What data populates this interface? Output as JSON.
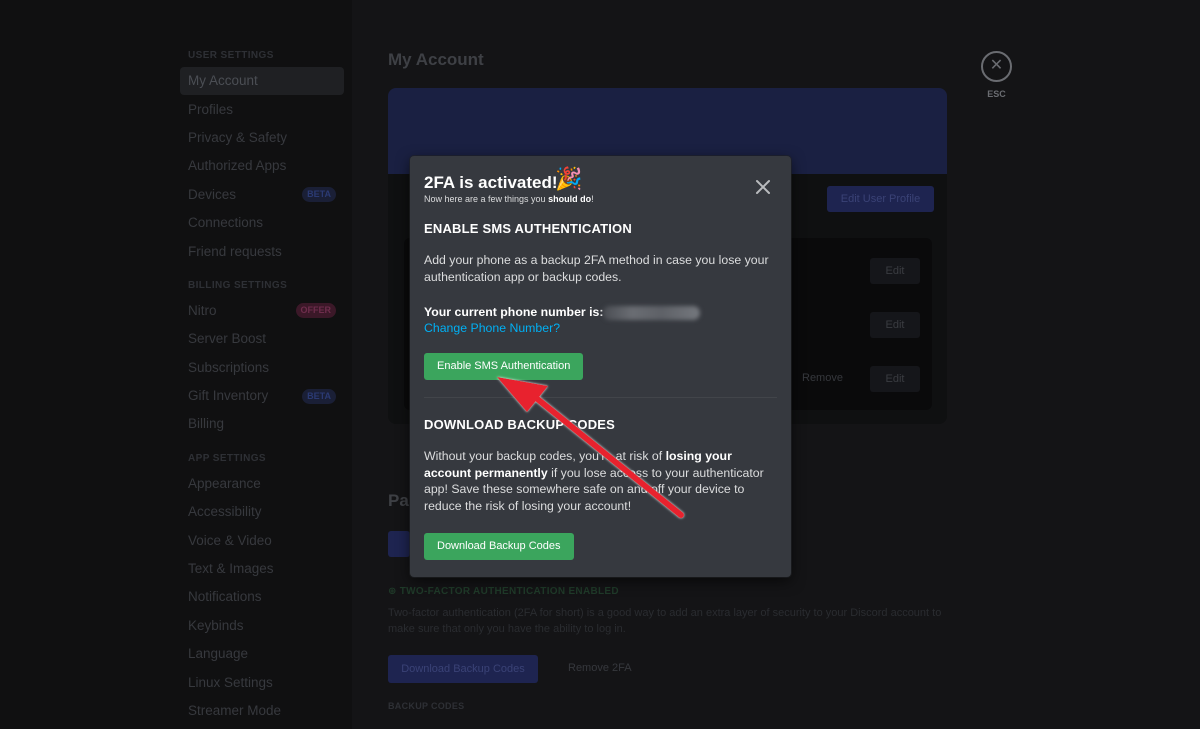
{
  "sidebar": {
    "sections": [
      {
        "title": "User Settings",
        "items": [
          {
            "label": "My Account",
            "active": true
          },
          {
            "label": "Profiles"
          },
          {
            "label": "Privacy & Safety"
          },
          {
            "label": "Authorized Apps"
          },
          {
            "label": "Devices",
            "badge": "BETA"
          },
          {
            "label": "Connections"
          },
          {
            "label": "Friend requests"
          }
        ]
      },
      {
        "title": "Billing Settings",
        "items": [
          {
            "label": "Nitro",
            "badge": "OFFER"
          },
          {
            "label": "Server Boost"
          },
          {
            "label": "Subscriptions"
          },
          {
            "label": "Gift Inventory",
            "badge": "BETA"
          },
          {
            "label": "Billing"
          }
        ]
      },
      {
        "title": "App Settings",
        "items": [
          {
            "label": "Appearance"
          },
          {
            "label": "Accessibility"
          },
          {
            "label": "Voice & Video"
          },
          {
            "label": "Text & Images"
          },
          {
            "label": "Notifications"
          },
          {
            "label": "Keybinds"
          },
          {
            "label": "Language"
          },
          {
            "label": "Linux Settings"
          },
          {
            "label": "Streamer Mode"
          }
        ]
      }
    ]
  },
  "page": {
    "title": "My Account",
    "edit_profile": "Edit User Profile",
    "edit_label": "Edit",
    "remove_label": "Remove",
    "password_heading": "Pa",
    "twofa_heading": "⊕ TWO-FACTOR AUTHENTICATION ENABLED",
    "twofa_body": "Two-factor authentication (2FA for short) is a good way to add an extra layer of security to your Discord account to make sure that only you have the ability to log in.",
    "download_backup": "Download Backup Codes",
    "remove_2fa": "Remove 2FA",
    "backup_codes_heading": "BACKUP CODES",
    "esc_label": "ESC"
  },
  "modal": {
    "title": "2FA is activated!",
    "title_emoji": "🎉",
    "subtitle_prefix": "Now here are a few things you ",
    "subtitle_bold": "should do",
    "subtitle_suffix": "!",
    "sms_heading": "ENABLE SMS AUTHENTICATION",
    "sms_text": "Add your phone as a backup 2FA method in case you lose your authentication app or backup codes.",
    "phone_label": "Your current phone number is:",
    "change_phone": "Change Phone Number?",
    "enable_sms_button": "Enable SMS Authentication",
    "backup_heading": "DOWNLOAD BACKUP CODES",
    "backup_text_1": "Without your backup codes, you're at risk of ",
    "backup_text_bold": "losing your account permanently",
    "backup_text_2": " if you lose access to your authenticator app! Save these somewhere safe on and off your device to reduce the risk of losing your account!",
    "download_button": "Download Backup Codes"
  },
  "colors": {
    "accent_green": "#3ba55d",
    "link_blue": "#00b0f4",
    "arrow_red": "#e8232e",
    "modal_bg": "#36393f"
  }
}
